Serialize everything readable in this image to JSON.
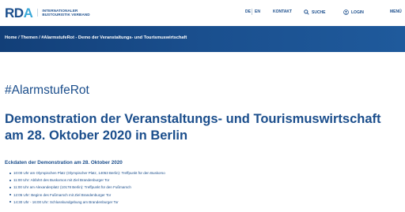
{
  "header": {
    "logo": "RDA",
    "logo_line1": "INTERNATIONALER",
    "logo_line2": "BUSTOURISTIK VERBAND",
    "lang_de": "DE",
    "lang_en": "EN",
    "kontakt": "KONTAKT",
    "suche": "SUCHE",
    "login": "LOGIN",
    "menu": "MENÜ"
  },
  "breadcrumb": "Home / Themen / #AlarmstufeRot - Demo der Veranstaltungs- und Tourismuswirtschaft",
  "main": {
    "hashtag": "#AlarmstufeRot",
    "headline": "Demonstration der Veranstaltungs- und Tourismuswirtschaft am 28. Oktober 2020 in Berlin",
    "section_title": "Eckdaten der Demonstration am 28. Oktober 2020",
    "items": [
      "10:00 Uhr am Olympischen Platz (Olympischer Platz, 14053 Berlin): Treffpunkt für den Buskorso",
      "11:00 Uhr: Abfahrt des Buskorsos mit Ziel Brandenburger Tor",
      "11:00 Uhr am Alexanderplatz (10178 Berlin): Treffpunkt für den Fußmarsch",
      "12:05 Uhr: Beginn des Fußmarsch mit Ziel Brandenburger Tor",
      "14:30 Uhr - 16:00 Uhr: Schlusskundgebung am Brandenburger Tor"
    ]
  },
  "colors": {
    "primary": "#1b4e8c",
    "accent": "#3aa8d8",
    "banner": "#1a4f8e"
  },
  "icons": [
    "search-icon",
    "user-icon",
    "menu-icon"
  ]
}
